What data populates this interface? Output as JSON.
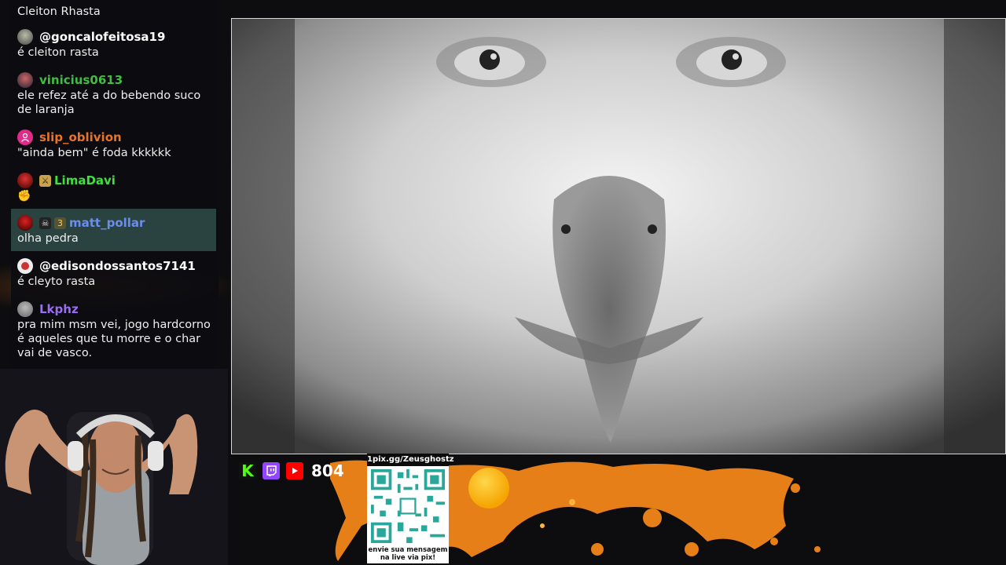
{
  "chat": {
    "messages": [
      {
        "user": "",
        "text": "Cleiton Rhasta",
        "color": "#ffffff"
      },
      {
        "user": "@goncalofeitosa19",
        "text": "é cleiton rasta",
        "color": "#ffffff"
      },
      {
        "user": "vinicius0613",
        "text": "ele refez até a do bebendo suco de laranja",
        "color": "#3fbf3f"
      },
      {
        "user": "slip_oblivion",
        "text": "\"ainda bem\" é foda kkkkkk",
        "color": "#e8742a"
      },
      {
        "user": "LimaDavi",
        "text": "",
        "color": "#3fe03f"
      },
      {
        "user": "matt_pollar",
        "text": "olha pedra",
        "color": "#6b8df0"
      },
      {
        "user": "@edisondossantos7141",
        "text": "é cleyto rasta",
        "color": "#ffffff"
      },
      {
        "user": "Lkphz",
        "text": "pra mim msm vei, jogo hardcorno é aqueles que tu morre e o char vai de vasco.",
        "color": "#9b6cf5"
      }
    ]
  },
  "stream": {
    "viewer_count": "804",
    "platform_icons": [
      "kick-icon",
      "twitch-icon",
      "youtube-icon"
    ]
  },
  "pix": {
    "link": "1pix.gg/Zeusghostz",
    "caption": "envie sua mensagem na live via pix!"
  },
  "colors": {
    "accent_orange": "#f08a1a",
    "highlight_row": "#2a4340",
    "kick_green": "#53fc18",
    "twitch_purple": "#9146ff",
    "youtube_red": "#ff0000"
  }
}
